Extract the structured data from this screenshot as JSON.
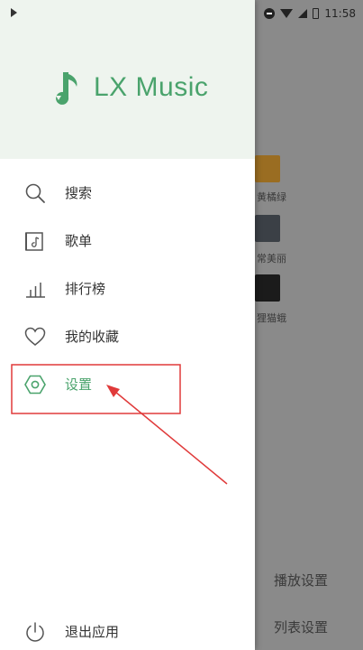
{
  "status_bar": {
    "time": "11:58"
  },
  "drawer": {
    "app_title": "LX Music",
    "menu": [
      {
        "id": "search",
        "label": "搜索",
        "icon": "search-icon"
      },
      {
        "id": "playlist",
        "label": "歌单",
        "icon": "playlist-icon"
      },
      {
        "id": "leaderboard",
        "label": "排行榜",
        "icon": "bar-chart-icon"
      },
      {
        "id": "favorites",
        "label": "我的收藏",
        "icon": "heart-icon"
      },
      {
        "id": "settings",
        "label": "设置",
        "icon": "hexagon-settings-icon",
        "active": true
      },
      {
        "id": "exit",
        "label": "退出应用",
        "icon": "power-icon"
      }
    ]
  },
  "background_app": {
    "items": [
      {
        "label": "黄橘绿",
        "thumb_color": "#9a6d22"
      },
      {
        "label": "常美丽",
        "thumb_color": "#3b4046"
      },
      {
        "label": "狸猫蛾",
        "thumb_color": "#1b1b1b"
      }
    ],
    "bottom_options": [
      "播放设置",
      "列表设置"
    ]
  },
  "colors": {
    "accent": "#4aa36c",
    "header_bg": "#eef4ee",
    "highlight_box": "#e03a3a"
  }
}
